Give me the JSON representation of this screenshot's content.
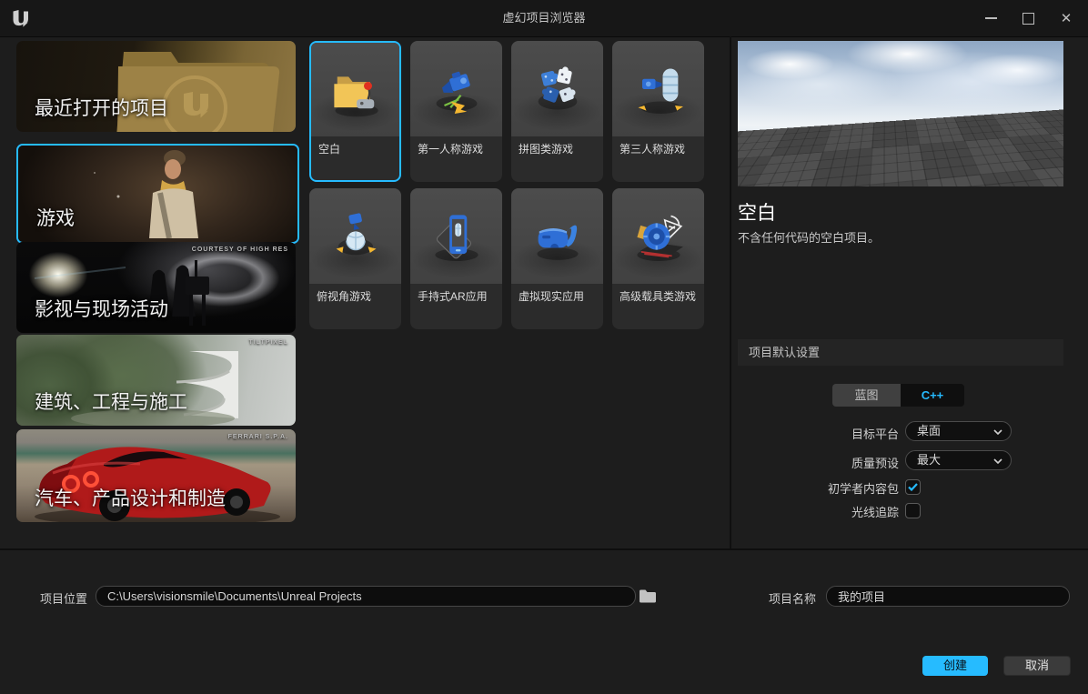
{
  "window": {
    "title": "虚幻项目浏览器"
  },
  "sidebar": {
    "recent": {
      "label": "最近打开的项目"
    },
    "categories": [
      {
        "label": "游戏",
        "selected": true,
        "credit": ""
      },
      {
        "label": "影视与现场活动",
        "selected": false,
        "credit": "COURTESY OF HIGH RES"
      },
      {
        "label": "建筑、工程与施工",
        "selected": false,
        "credit": "TILTPIXEL"
      },
      {
        "label": "汽车、产品设计和制造",
        "selected": false,
        "credit": "FERRARI S.P.A."
      }
    ]
  },
  "templates": {
    "items": [
      {
        "label": "空白",
        "selected": true
      },
      {
        "label": "第一人称游戏",
        "selected": false
      },
      {
        "label": "拼图类游戏",
        "selected": false
      },
      {
        "label": "第三人称游戏",
        "selected": false
      },
      {
        "label": "俯视角游戏",
        "selected": false
      },
      {
        "label": "手持式AR应用",
        "selected": false
      },
      {
        "label": "虚拟现实应用",
        "selected": false
      },
      {
        "label": "高级载具类游戏",
        "selected": false
      }
    ]
  },
  "detail": {
    "title": "空白",
    "description": "不含任何代码的空白项目。",
    "defaults_header": "项目默认设置",
    "blueprint_label": "蓝图",
    "cpp_label": "C++",
    "target_platform_label": "目标平台",
    "target_platform_value": "桌面",
    "quality_label": "质量预设",
    "quality_value": "最大",
    "starter_content_label": "初学者内容包",
    "starter_content_checked": true,
    "raytracing_label": "光线追踪",
    "raytracing_checked": false
  },
  "footer": {
    "location_label": "项目位置",
    "location_value": "C:\\Users\\visionsmile\\Documents\\Unreal Projects",
    "name_label": "项目名称",
    "name_value": "我的项目",
    "create_label": "创建",
    "cancel_label": "取消"
  },
  "colors": {
    "accent": "#26bbff",
    "create_button": "#26bbff",
    "selection_border": "#26bbff"
  }
}
